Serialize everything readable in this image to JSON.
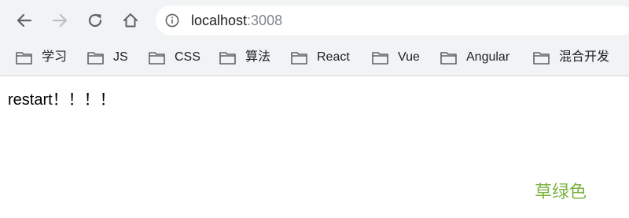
{
  "browser": {
    "url_host": "localhost",
    "url_port": ":3008",
    "icons": {
      "back": "arrow-left-icon",
      "forward": "arrow-right-icon",
      "reload": "reload-icon",
      "home": "home-icon",
      "info": "info-icon",
      "folder": "folder-icon"
    }
  },
  "bookmarks": [
    {
      "label": "学习"
    },
    {
      "label": "JS"
    },
    {
      "label": "CSS"
    },
    {
      "label": "算法"
    },
    {
      "label": "React"
    },
    {
      "label": "Vue"
    },
    {
      "label": "Angular"
    },
    {
      "label": "混合开发"
    }
  ],
  "page": {
    "restart_text": "restart！！！！",
    "green_text": "草绿色",
    "green_color": "#7cb342"
  },
  "colors": {
    "chrome_bg": "#f1f3f4",
    "forward_disabled": "#bdc1c6",
    "icon_active": "#5f6368"
  }
}
